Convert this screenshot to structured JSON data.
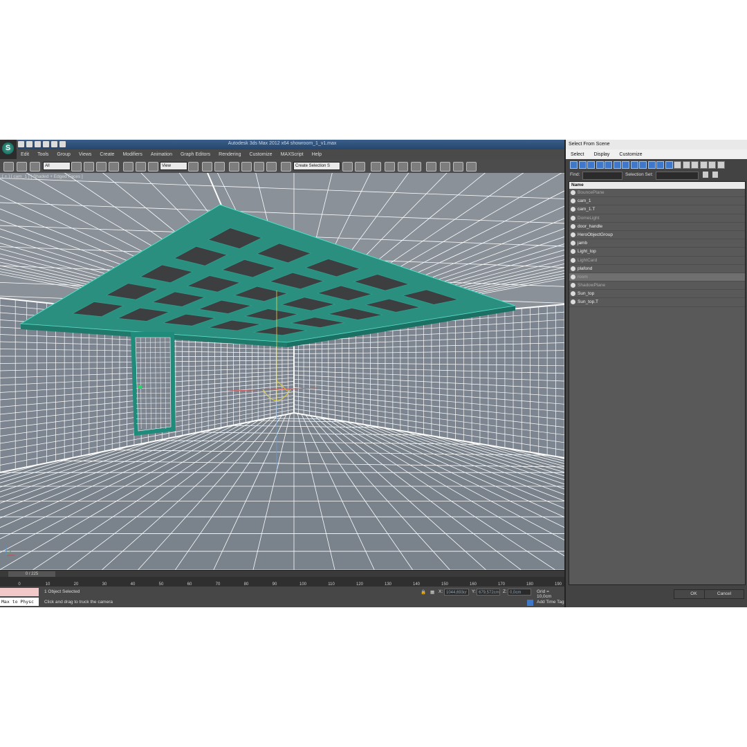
{
  "window": {
    "title": "Autodesk 3ds Max  2012 x64      showroom_1_v1.max",
    "menu": [
      "Edit",
      "Tools",
      "Group",
      "Views",
      "Create",
      "Modifiers",
      "Animation",
      "Graph Editors",
      "Rendering",
      "Customize",
      "MAXScript",
      "Help"
    ]
  },
  "toolbar": {
    "filter_value": "All",
    "refcoord_value": "View",
    "selection_set_value": "Create Selection S"
  },
  "viewport": {
    "label": "[ + ] [ cam_1 ] [ Shaded + Edged Faces ]"
  },
  "timeline": {
    "frame_readout": "0 / 225",
    "ticks": [
      "0",
      "10",
      "20",
      "30",
      "40",
      "50",
      "60",
      "70",
      "80",
      "90",
      "100",
      "110",
      "120",
      "130",
      "140",
      "150",
      "160",
      "170",
      "180",
      "190"
    ]
  },
  "status": {
    "selected": "1 Object Selected",
    "prompt": "Click and drag to truck the camera",
    "maxscript": "Max to Physc",
    "x_label": "X:",
    "x_value": "1044,693cr",
    "y_label": "Y:",
    "y_value": "679,572cm",
    "z_label": "Z:",
    "z_value": "0,0cm",
    "grid": "Grid = 10,0cm",
    "add_time_tag": "Add Time Tag"
  },
  "dialog": {
    "title": "Select From Scene",
    "menu": [
      "Select",
      "Display",
      "Customize"
    ],
    "find_label": "Find:",
    "selection_set_label": "Selection Set:",
    "column_header": "Name",
    "items": [
      {
        "name": "BouncePlane",
        "dim": true
      },
      {
        "name": "cam_1",
        "dim": false
      },
      {
        "name": "cam_1.T",
        "dim": false
      },
      {
        "name": "DomeLight",
        "dim": true
      },
      {
        "name": "door_handle",
        "dim": false
      },
      {
        "name": "HeroObjectGroup",
        "dim": false
      },
      {
        "name": "jamb",
        "dim": false
      },
      {
        "name": "Light_top",
        "dim": false
      },
      {
        "name": "LightCard",
        "dim": true
      },
      {
        "name": "plafond",
        "dim": false
      },
      {
        "name": "room",
        "dim": true
      },
      {
        "name": "ShadowPlane",
        "dim": true
      },
      {
        "name": "Sun_top",
        "dim": false
      },
      {
        "name": "Sun_top.T",
        "dim": false
      }
    ],
    "ok": "OK",
    "cancel": "Cancel"
  }
}
